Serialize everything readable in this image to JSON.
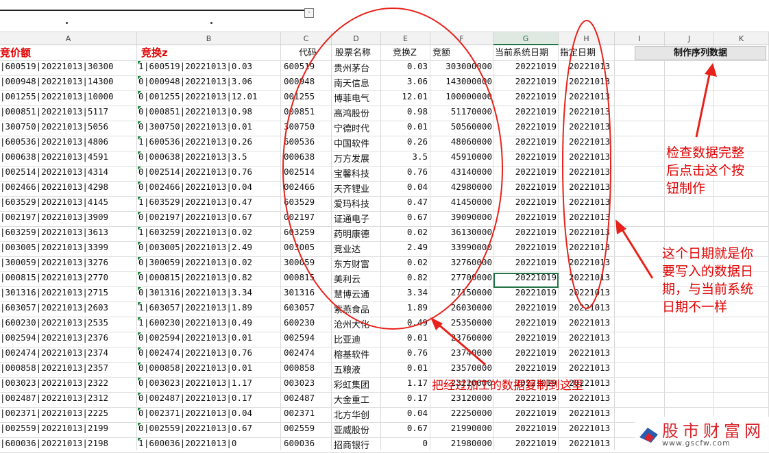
{
  "column_headers": [
    "A",
    "B",
    "C",
    "D",
    "E",
    "F",
    "G",
    "H",
    "I",
    "J",
    "K"
  ],
  "header_row": {
    "a": "竞价额",
    "b": "竞换z",
    "c": "代码",
    "d": "股票名称",
    "e": "竞换Z",
    "f": "竞额",
    "g": "当前系统日期",
    "h": "指定日期"
  },
  "make_button_label": "制作序列数据",
  "rows": [
    {
      "a": "|600519|20221013|30300",
      "b_flag": "1",
      "b": "|600519|20221013|0.03",
      "c": "600519",
      "d": "贵州茅台",
      "e": "0.03",
      "f": "303000000",
      "g": "20221019",
      "h": "20221013"
    },
    {
      "a": "|000948|20221013|14300",
      "b_flag": "0",
      "b": "|000948|20221013|3.06",
      "c": "000948",
      "d": "南天信息",
      "e": "3.06",
      "f": "143000000",
      "g": "20221019",
      "h": "20221013"
    },
    {
      "a": "|001255|20221013|10000",
      "b_flag": "0",
      "b": "|001255|20221013|12.01",
      "c": "001255",
      "d": "博菲电气",
      "e": "12.01",
      "f": "100000000",
      "g": "20221019",
      "h": "20221013"
    },
    {
      "a": "|000851|20221013|5117",
      "b_flag": "0",
      "b": "|000851|20221013|0.98",
      "c": "000851",
      "d": "高鸿股份",
      "e": "0.98",
      "f": "51170000",
      "g": "20221019",
      "h": "20221013"
    },
    {
      "a": "|300750|20221013|5056",
      "b_flag": "0",
      "b": "|300750|20221013|0.01",
      "c": "300750",
      "d": "宁德时代",
      "e": "0.01",
      "f": "50560000",
      "g": "20221019",
      "h": "20221013"
    },
    {
      "a": "|600536|20221013|4806",
      "b_flag": "1",
      "b": "|600536|20221013|0.26",
      "c": "600536",
      "d": "中国软件",
      "e": "0.26",
      "f": "48060000",
      "g": "20221019",
      "h": "20221013"
    },
    {
      "a": "|000638|20221013|4591",
      "b_flag": "0",
      "b": "|000638|20221013|3.5",
      "c": "000638",
      "d": "万方发展",
      "e": "3.5",
      "f": "45910000",
      "g": "20221019",
      "h": "20221013"
    },
    {
      "a": "|002514|20221013|4314",
      "b_flag": "0",
      "b": "|002514|20221013|0.76",
      "c": "002514",
      "d": "宝馨科技",
      "e": "0.76",
      "f": "43140000",
      "g": "20221019",
      "h": "20221013"
    },
    {
      "a": "|002466|20221013|4298",
      "b_flag": "0",
      "b": "|002466|20221013|0.04",
      "c": "002466",
      "d": "天齐锂业",
      "e": "0.04",
      "f": "42980000",
      "g": "20221019",
      "h": "20221013"
    },
    {
      "a": "|603529|20221013|4145",
      "b_flag": "1",
      "b": "|603529|20221013|0.47",
      "c": "603529",
      "d": "爱玛科技",
      "e": "0.47",
      "f": "41450000",
      "g": "20221019",
      "h": "20221013"
    },
    {
      "a": "|002197|20221013|3909",
      "b_flag": "0",
      "b": "|002197|20221013|0.67",
      "c": "002197",
      "d": "证通电子",
      "e": "0.67",
      "f": "39090000",
      "g": "20221019",
      "h": "20221013"
    },
    {
      "a": "|603259|20221013|3613",
      "b_flag": "1",
      "b": "|603259|20221013|0.02",
      "c": "603259",
      "d": "药明康德",
      "e": "0.02",
      "f": "36130000",
      "g": "20221019",
      "h": "20221013"
    },
    {
      "a": "|003005|20221013|3399",
      "b_flag": "0",
      "b": "|003005|20221013|2.49",
      "c": "003005",
      "d": "竞业达",
      "e": "2.49",
      "f": "33990000",
      "g": "20221019",
      "h": "20221013"
    },
    {
      "a": "|300059|20221013|3276",
      "b_flag": "0",
      "b": "|300059|20221013|0.02",
      "c": "300059",
      "d": "东方财富",
      "e": "0.02",
      "f": "32760000",
      "g": "20221019",
      "h": "20221013"
    },
    {
      "a": "|000815|20221013|2770",
      "b_flag": "0",
      "b": "|000815|20221013|0.82",
      "c": "000815",
      "d": "美利云",
      "e": "0.82",
      "f": "27700000",
      "g": "20221019",
      "h": "20221013"
    },
    {
      "a": "|301316|20221013|2715",
      "b_flag": "0",
      "b": "|301316|20221013|3.34",
      "c": "301316",
      "d": "慧博云通",
      "e": "3.34",
      "f": "27150000",
      "g": "20221019",
      "h": "20221013"
    },
    {
      "a": "|603057|20221013|2603",
      "b_flag": "1",
      "b": "|603057|20221013|1.89",
      "c": "603057",
      "d": "紫燕食品",
      "e": "1.89",
      "f": "26030000",
      "g": "20221019",
      "h": "20221013"
    },
    {
      "a": "|600230|20221013|2535",
      "b_flag": "1",
      "b": "|600230|20221013|0.49",
      "c": "600230",
      "d": "沧州大化",
      "e": "0.49",
      "f": "25350000",
      "g": "20221019",
      "h": "20221013"
    },
    {
      "a": "|002594|20221013|2376",
      "b_flag": "0",
      "b": "|002594|20221013|0.01",
      "c": "002594",
      "d": "比亚迪",
      "e": "0.01",
      "f": "23760000",
      "g": "20221019",
      "h": "20221013"
    },
    {
      "a": "|002474|20221013|2374",
      "b_flag": "0",
      "b": "|002474|20221013|0.76",
      "c": "002474",
      "d": "榕基软件",
      "e": "0.76",
      "f": "23740000",
      "g": "20221019",
      "h": "20221013"
    },
    {
      "a": "|000858|20221013|2357",
      "b_flag": "0",
      "b": "|000858|20221013|0.01",
      "c": "000858",
      "d": "五粮液",
      "e": "0.01",
      "f": "23570000",
      "g": "20221019",
      "h": "20221013"
    },
    {
      "a": "|003023|20221013|2322",
      "b_flag": "0",
      "b": "|003023|20221013|1.17",
      "c": "003023",
      "d": "彩虹集团",
      "e": "1.17",
      "f": "23220000",
      "g": "20221019",
      "h": "20221013"
    },
    {
      "a": "|002487|20221013|2312",
      "b_flag": "0",
      "b": "|002487|20221013|0.17",
      "c": "002487",
      "d": "大金重工",
      "e": "0.17",
      "f": "23120000",
      "g": "20221019",
      "h": "20221013"
    },
    {
      "a": "|002371|20221013|2225",
      "b_flag": "0",
      "b": "|002371|20221013|0.04",
      "c": "002371",
      "d": "北方华创",
      "e": "0.04",
      "f": "22250000",
      "g": "20221019",
      "h": "20221013"
    },
    {
      "a": "|002559|20221013|2199",
      "b_flag": "0",
      "b": "|002559|20221013|0.67",
      "c": "002559",
      "d": "亚威股份",
      "e": "0.67",
      "f": "21990000",
      "g": "20221019",
      "h": "20221013"
    },
    {
      "a": "|600036|20221013|2198",
      "b_flag": "1",
      "b": "|600036|20221013|0",
      "c": "600036",
      "d": "招商银行",
      "e": "0",
      "f": "21980000",
      "g": "20221019",
      "h": "20221013"
    }
  ],
  "annotations": {
    "check_note": [
      "检查数据完整",
      "后点击这个按",
      "钮制作"
    ],
    "date_note": [
      "这个日期就是你",
      "要写入的数据日",
      "期，与当前系统",
      "日期不一样"
    ],
    "paste_note": "把经过加工的数据复制到这里"
  },
  "watermark": {
    "title": "股市财富网",
    "url": "www.gscfw.com"
  },
  "colors": {
    "annotation": "#e00000",
    "selection": "#217346",
    "watermark": "#d8232a"
  }
}
